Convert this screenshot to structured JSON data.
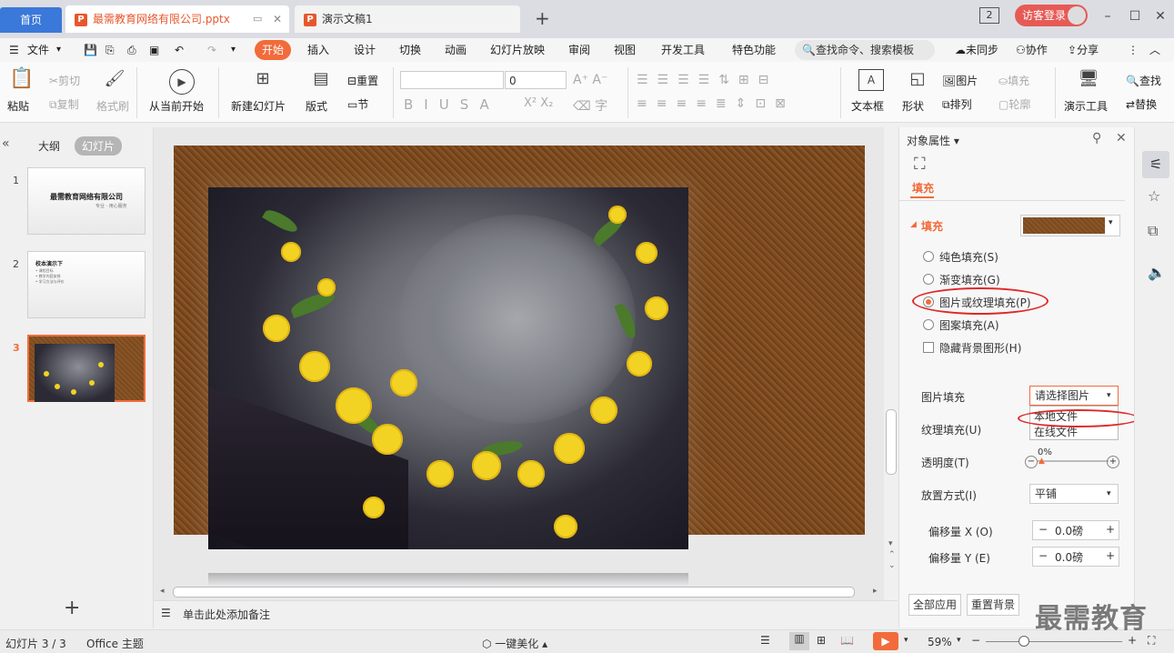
{
  "titlebar": {
    "home_tab": "首页",
    "doc_tab_1": "最需教育网络有限公司.pptx",
    "doc_tab_2": "演示文稿1",
    "add_tab": "+",
    "badge": "2",
    "login": "访客登录"
  },
  "menubar": {
    "file": "文件",
    "items": [
      "开始",
      "插入",
      "设计",
      "切换",
      "动画",
      "幻灯片放映",
      "审阅",
      "视图",
      "开发工具",
      "特色功能"
    ],
    "search_placeholder": "查找命令、搜索模板",
    "sync": "未同步",
    "collab": "协作",
    "share": "分享"
  },
  "ribbon": {
    "paste": "粘贴",
    "cut": "剪切",
    "copy": "复制",
    "format_painter": "格式刷",
    "from_current": "从当前开始",
    "new_slide": "新建幻灯片",
    "layout": "版式",
    "reset": "重置",
    "section": "节",
    "font_size": "0",
    "textbox": "文本框",
    "shape": "形状",
    "picture": "图片",
    "fill": "填充",
    "arrange": "排列",
    "outline": "轮廓",
    "present_tools": "演示工具",
    "find": "查找",
    "replace": "替换"
  },
  "leftpanel": {
    "tab_outline": "大纲",
    "tab_slides": "幻灯片",
    "slides": [
      {
        "num": "1",
        "title": "最需教育网络有限公司",
        "sub": "专业 · 用心服务"
      },
      {
        "num": "2",
        "title": "校本演示下",
        "lines": [
          "• 课程目标",
          "• 教学内容安排",
          "• 学习方法与评价"
        ]
      },
      {
        "num": "3"
      }
    ],
    "add": "+"
  },
  "rightpanel": {
    "header": "对象属性",
    "tab_fill": "填充",
    "section_fill": "填充",
    "options": [
      "纯色填充(S)",
      "渐变填充(G)",
      "图片或纹理填充(P)",
      "图案填充(A)"
    ],
    "hide_bg": "隐藏背景图形(H)",
    "pic_fill_label": "图片填充",
    "pic_fill_value": "请选择图片",
    "menu_local": "本地文件",
    "menu_online": "在线文件",
    "texture_label": "纹理填充(U)",
    "transparency_label": "透明度(T)",
    "transparency_value": "0%",
    "placement_label": "放置方式(I)",
    "placement_value": "平铺",
    "offset_x_label": "偏移量 X (O)",
    "offset_x_value": "0.0磅",
    "offset_y_label": "偏移量 Y (E)",
    "offset_y_value": "0.0磅",
    "apply_all": "全部应用",
    "reset_bg": "重置背景"
  },
  "notes": {
    "placeholder": "单击此处添加备注"
  },
  "statusbar": {
    "slide_count": "幻灯片 3 / 3",
    "theme": "Office 主题",
    "beautify": "一键美化",
    "zoom": "59%"
  },
  "watermark": "最需教育",
  "colors": {
    "accent": "#f26b3a",
    "home_tab": "#3a78d9",
    "annotation": "#e02828"
  }
}
